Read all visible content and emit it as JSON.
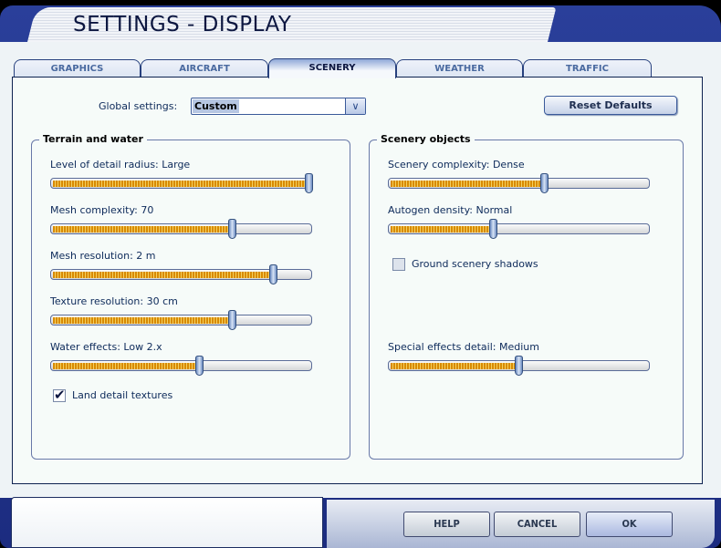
{
  "window": {
    "title": "SETTINGS - DISPLAY"
  },
  "tabs": [
    {
      "label": "GRAPHICS"
    },
    {
      "label": "AIRCRAFT"
    },
    {
      "label": "SCENERY",
      "active": true
    },
    {
      "label": "WEATHER"
    },
    {
      "label": "TRAFFIC"
    }
  ],
  "global": {
    "label": "Global settings:",
    "value": "Custom",
    "dropdown_icon": "chevron-down-icon"
  },
  "reset_label": "Reset Defaults",
  "terrain": {
    "title": "Terrain and water",
    "sliders": [
      {
        "label": "Level of detail radius: Large",
        "value": 1.0
      },
      {
        "label": "Mesh complexity: 70",
        "value": 0.7
      },
      {
        "label": "Mesh resolution: 2 m",
        "value": 0.86
      },
      {
        "label": "Texture resolution: 30 cm",
        "value": 0.7
      },
      {
        "label": "Water effects: Low 2.x",
        "value": 0.57
      }
    ],
    "checkbox": {
      "label": "Land detail textures",
      "checked": true
    }
  },
  "scenery": {
    "title": "Scenery objects",
    "sliders": [
      {
        "label": "Scenery complexity: Dense",
        "value": 0.6
      },
      {
        "label": "Autogen density: Normal",
        "value": 0.4
      },
      {
        "label": "Special effects detail: Medium",
        "value": 0.5
      }
    ],
    "checkbox": {
      "label": "Ground scenery shadows",
      "checked": false
    }
  },
  "buttons": {
    "help": "HELP",
    "cancel": "CANCEL",
    "ok": "OK"
  }
}
